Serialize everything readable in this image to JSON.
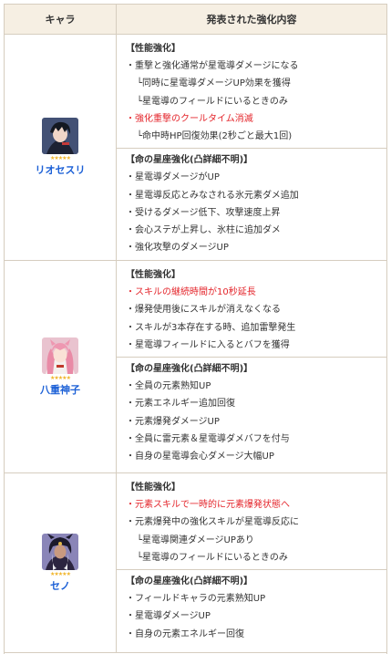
{
  "header": {
    "col_char": "キャラ",
    "col_content": "発表された強化内容"
  },
  "rows": [
    {
      "name": "リオセスリ",
      "stars": "★★★★★",
      "perf_title": "【性能強化】",
      "perf": [
        {
          "text": "・重撃と強化通常が星電導ダメージになる",
          "red": false
        },
        {
          "text": "└同時に星電導ダメージUP効果を獲得",
          "sub": true
        },
        {
          "text": "└星電導のフィールドにいるときのみ",
          "sub": true
        },
        {
          "text": "・強化重撃のクールタイム消滅",
          "red": true
        },
        {
          "text": "└命中時HP回復効果(2秒ごと最大1回)",
          "sub": true
        }
      ],
      "const_title": "【命の星座強化(凸詳細不明)】",
      "const": [
        "・星電導ダメージがUP",
        "・星電導反応とみなされる氷元素ダメ追加",
        "・受けるダメージ低下、攻撃速度上昇",
        "・会心ステが上昇し、氷柱に追加ダメ",
        "・強化攻撃のダメージUP"
      ]
    },
    {
      "name": "八重神子",
      "stars": "★★★★★",
      "perf_title": "【性能強化】",
      "perf": [
        {
          "text": "・スキルの継続時間が10秒延長",
          "red": true
        },
        {
          "text": "・爆発使用後にスキルが消えなくなる",
          "red": false
        },
        {
          "text": "・スキルが3本存在する時、追加雷撃発生",
          "red": false
        },
        {
          "text": "・星電導フィールドに入るとバフを獲得",
          "red": false
        }
      ],
      "const_title": "【命の星座強化(凸詳細不明)】",
      "const": [
        "・全員の元素熟知UP",
        "・元素エネルギー追加回復",
        "・元素爆発ダメージUP",
        "・全員に雷元素＆星電導ダメバフを付与",
        "・自身の星電導会心ダメージ大幅UP"
      ]
    },
    {
      "name": "セノ",
      "stars": "★★★★★",
      "perf_title": "【性能強化】",
      "perf": [
        {
          "text": "・元素スキルで一時的に元素爆発状態へ",
          "red": true
        },
        {
          "text": "・元素爆発中の強化スキルが星電導反応に",
          "red": false
        },
        {
          "text": "└星電導関連ダメージUPあり",
          "sub": true
        },
        {
          "text": "└星電導のフィールドにいるときのみ",
          "sub": true
        }
      ],
      "const_title": "【命の星座強化(凸詳細不明)】",
      "const": [
        "・フィールドキャラの元素熟知UP",
        "・星電導ダメージUP",
        "・自身の元素エネルギー回復"
      ]
    }
  ],
  "icons": [
    "wriothesley-avatar-icon",
    "yae-miko-avatar-icon",
    "cyno-avatar-icon",
    "star-rating-icon"
  ],
  "colors": {
    "header_bg": "#f6efe3",
    "border": "#d6cdbf",
    "name": "#1a5fd6",
    "highlight": "#e4262c"
  }
}
